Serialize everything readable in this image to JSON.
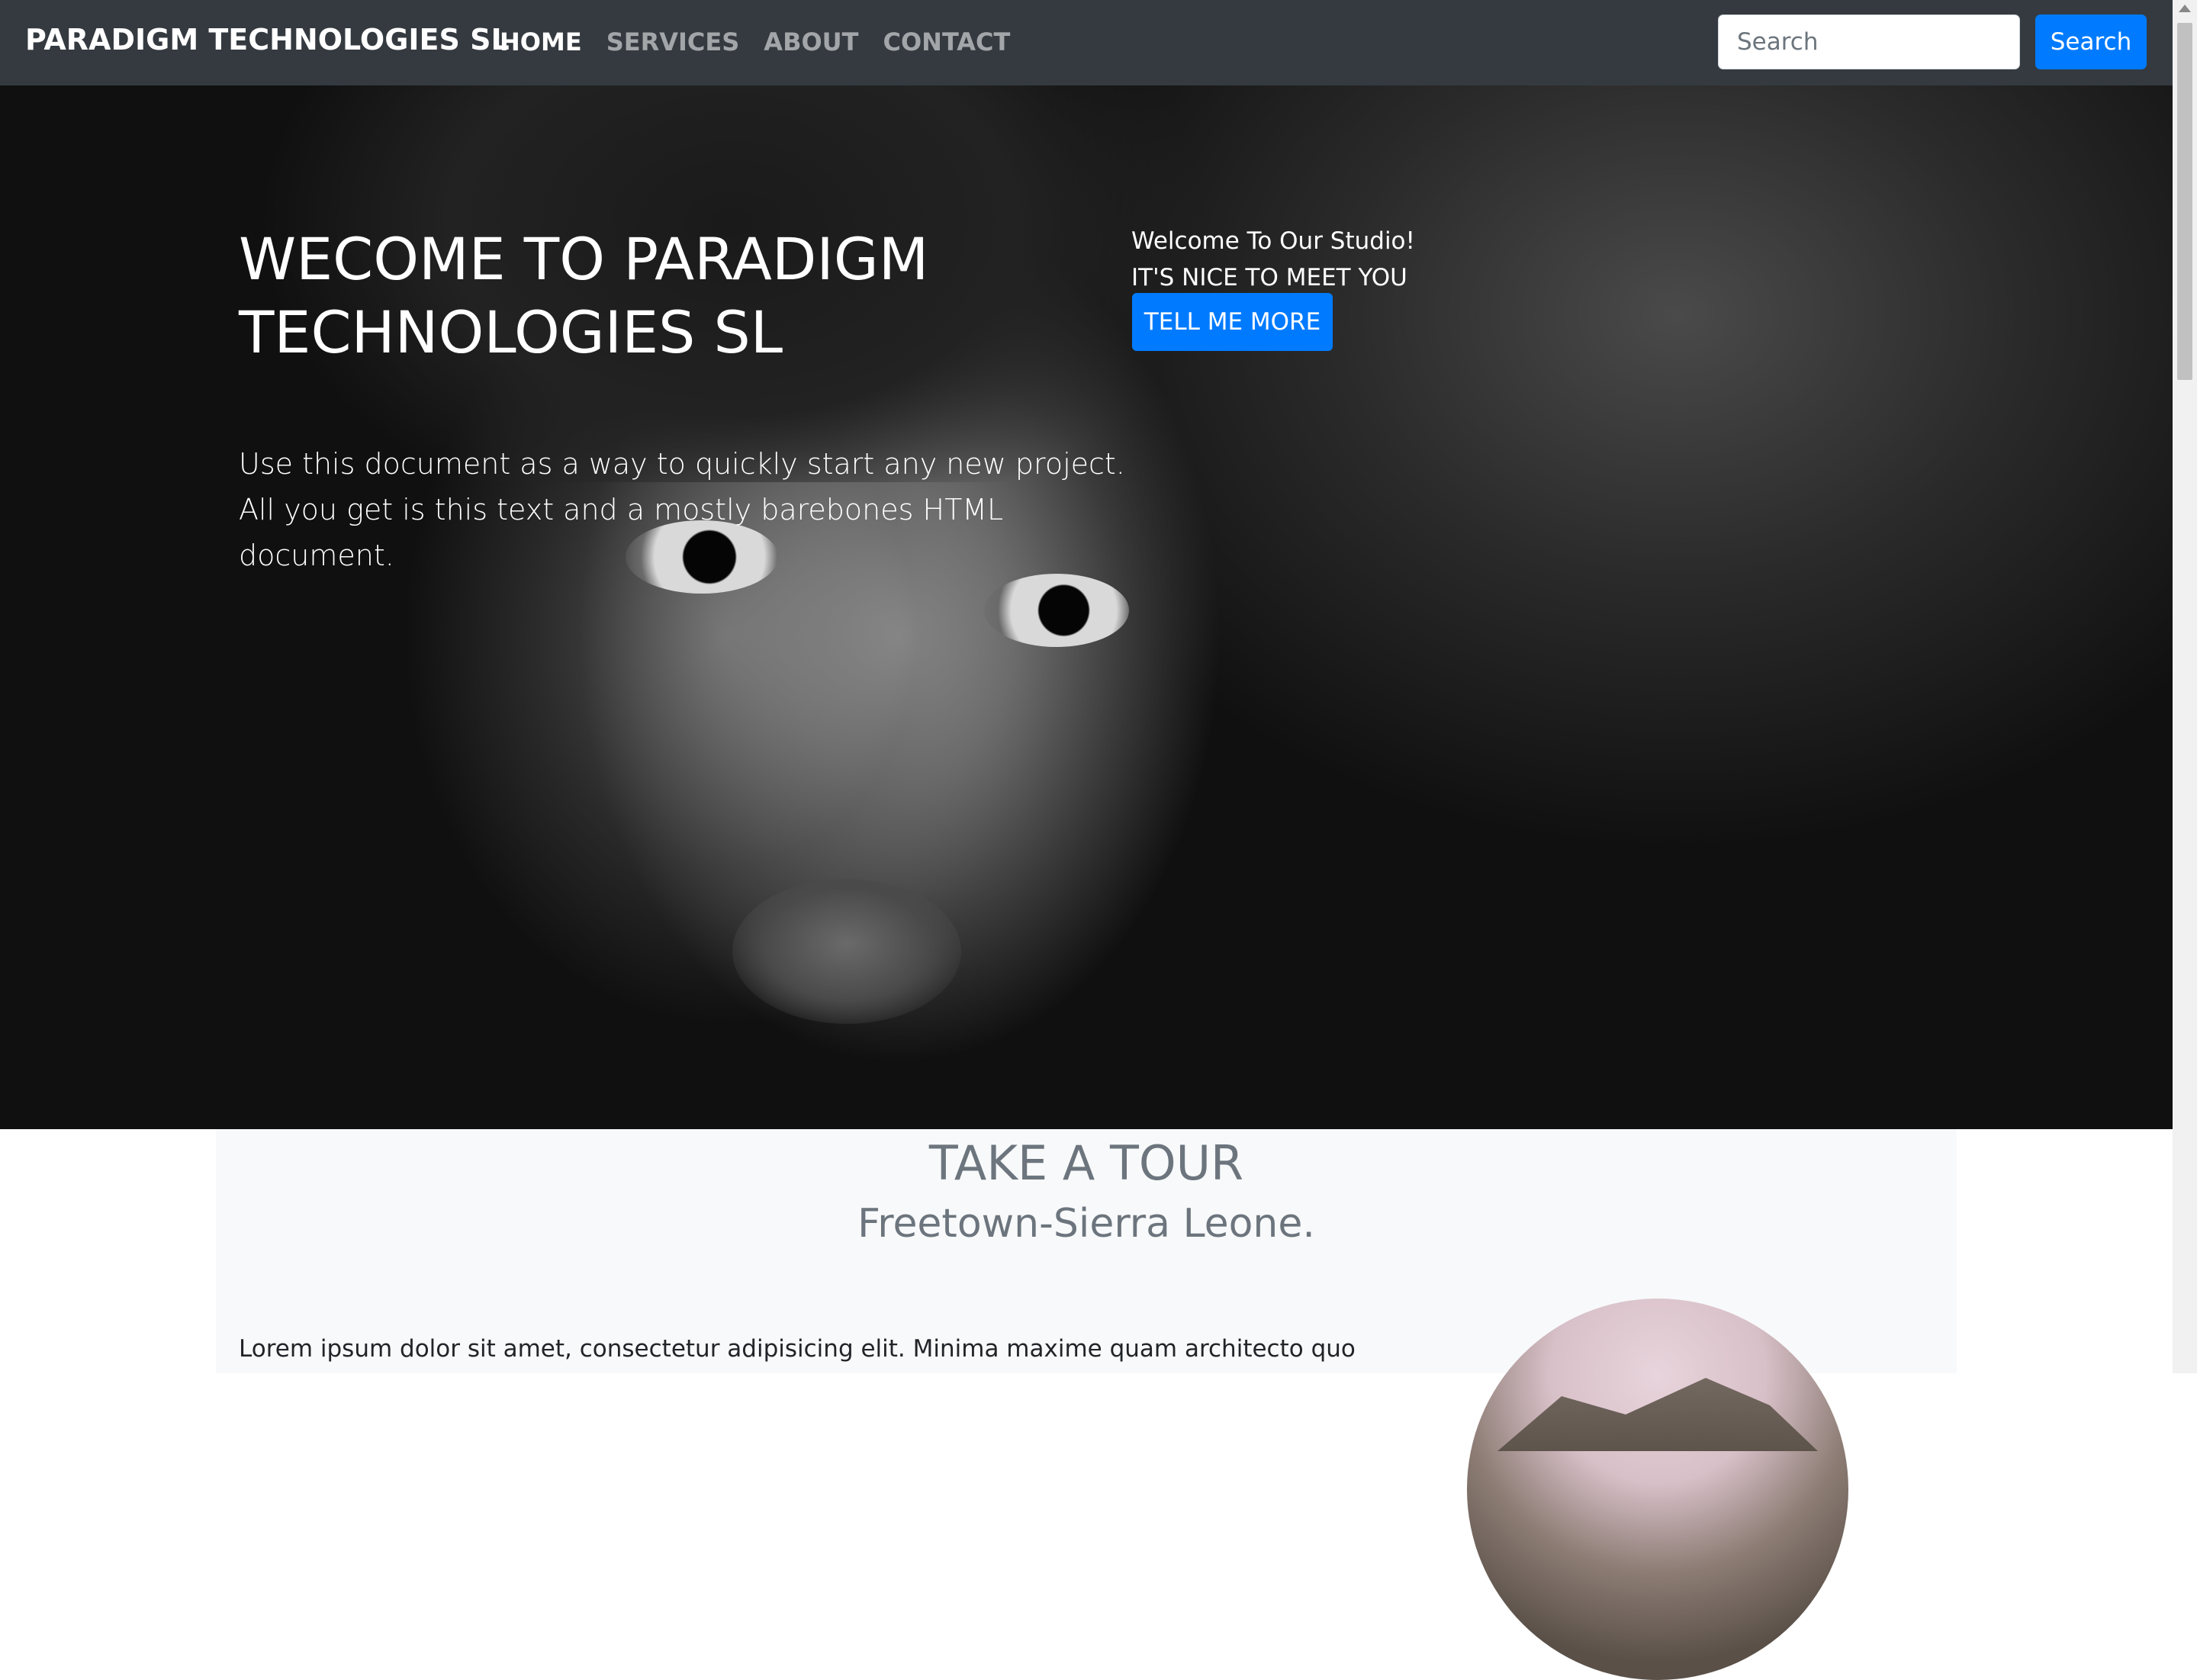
{
  "navbar": {
    "brand": "PARADIGM TECHNOLOGIES SL",
    "links": [
      {
        "label": "HOME",
        "active": true
      },
      {
        "label": "SERVICES",
        "active": false
      },
      {
        "label": "ABOUT",
        "active": false
      },
      {
        "label": "CONTACT",
        "active": false
      }
    ],
    "search": {
      "placeholder": "Search",
      "button_label": "Search"
    }
  },
  "hero": {
    "title": "WECOME TO PARADIGM TECHNOLOGIES SL",
    "text_line1": "Use this document as a way to quickly start any new project.",
    "text_line2": "All you get is this text and a mostly barebones HTML document.",
    "welcome_line1": "Welcome To Our Studio!",
    "welcome_line2": "IT'S NICE TO MEET YOU",
    "cta_label": "TELL ME MORE"
  },
  "tour": {
    "title": "TAKE A TOUR",
    "subtitle": "Freetown-Sierra Leone.",
    "body": "Lorem ipsum dolor sit amet, consectetur adipisicing elit. Minima maxime quam architecto quo"
  },
  "colors": {
    "navbar_bg": "#343a40",
    "primary": "#007bff",
    "muted_text": "#6c757d",
    "section_bg": "#f8f9fa"
  }
}
